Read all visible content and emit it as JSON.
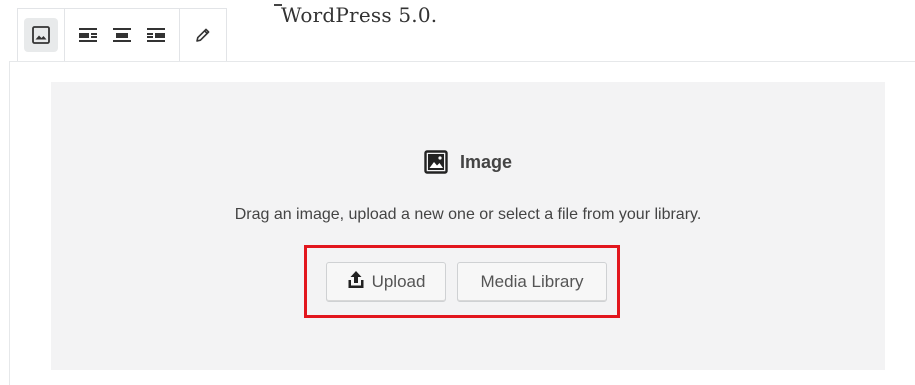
{
  "paragraph": {
    "text": "WordPress 5.0."
  },
  "toolbar": {
    "buttons": [
      {
        "name": "image-icon"
      },
      {
        "name": "align-left-icon"
      },
      {
        "name": "align-center-icon"
      },
      {
        "name": "align-right-icon"
      },
      {
        "name": "edit-pencil-icon"
      }
    ]
  },
  "image_block": {
    "title": "Image",
    "instructions": "Drag an image, upload a new one or select a file from your library.",
    "upload_label": "Upload",
    "media_library_label": "Media Library"
  },
  "colors": {
    "highlight": "#e2161d",
    "placeholder_bg": "#f3f3f4"
  }
}
